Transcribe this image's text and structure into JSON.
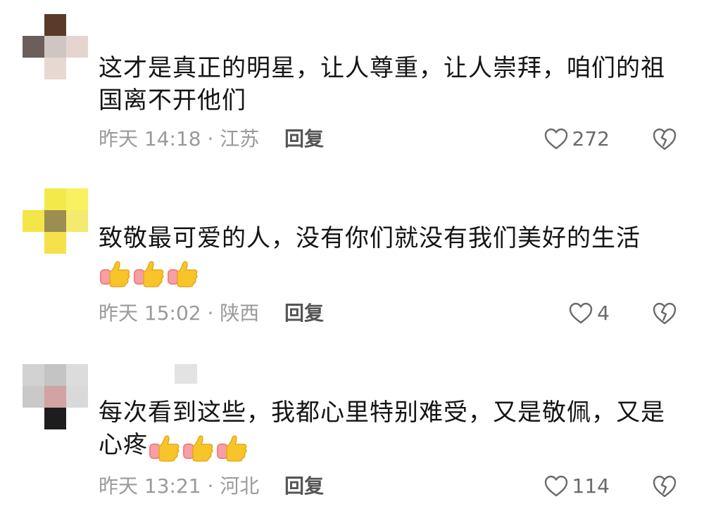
{
  "comments": [
    {
      "text": "这才是真正的明星，让人尊重，让人崇拜，咱们的祖国离不开他们",
      "time": "昨天 14:18",
      "location": "江苏",
      "meta": "昨天 14:18 · 江苏",
      "reply_label": "回复",
      "likes": "272",
      "avatar_colors": [
        "#ffffff",
        "#5a3a2a",
        "#ffffff",
        "#6b5f5c",
        "#cfc6c2",
        "#e4d5d0",
        "#ffffff",
        "#e8d8d2",
        "#ffffff"
      ],
      "emoji": []
    },
    {
      "text": "致敬最可爱的人，没有你们就没有我们美好的生活",
      "time": "昨天 15:02",
      "location": "陕西",
      "meta": "昨天 15:02 · 陕西",
      "reply_label": "回复",
      "likes": "4",
      "avatar_colors": [
        "#ffffff",
        "#f4e94a",
        "#f9f160",
        "#f4e648",
        "#9c8d52",
        "#f3ea6e",
        "#ffffff",
        "#f5e14a",
        "#ffffff"
      ],
      "emoji": [
        "thumbs-up",
        "thumbs-up",
        "thumbs-up"
      ]
    },
    {
      "text": "每次看到这些，我都心里特别难受，又是敬佩，又是心疼",
      "time": "昨天 13:21",
      "location": "河北",
      "meta": "昨天 13:21 · 河北",
      "reply_label": "回复",
      "likes": "114",
      "avatar_colors": [
        "#d2d2d2",
        "#c4c4c4",
        "#dcdcdc",
        "#c9c9c9",
        "#d1a3a3",
        "#d9d9d9",
        "#ffffff",
        "#1d1d1d",
        "#ffffff"
      ],
      "emoji": [
        "thumbs-up",
        "thumbs-up",
        "thumbs-up"
      ]
    }
  ],
  "icons": {
    "like": "heart-outline-icon",
    "dislike": "broken-heart-icon",
    "emoji": "thumbs-up-icon"
  }
}
